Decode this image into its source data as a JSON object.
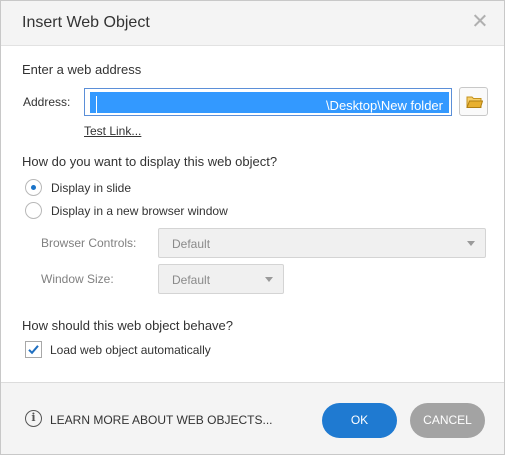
{
  "dialog": {
    "title": "Insert Web Object"
  },
  "address_section": {
    "heading": "Enter a web address",
    "address_label": "Address:",
    "address_value": "\\Desktop\\New folder",
    "test_link": "Test Link..."
  },
  "display_section": {
    "heading": "How do you want to display this web object?",
    "options": [
      {
        "label": "Display in slide",
        "selected": true
      },
      {
        "label": "Display in a new browser window",
        "selected": false
      }
    ],
    "browser_controls_label": "Browser Controls:",
    "browser_controls_value": "Default",
    "window_size_label": "Window Size:",
    "window_size_value": "Default"
  },
  "behave_section": {
    "heading": "How should this web object behave?",
    "load_auto_label": "Load web object automatically",
    "load_auto_checked": true
  },
  "footer": {
    "learn_more": "LEARN MORE ABOUT WEB OBJECTS...",
    "ok_label": "OK",
    "cancel_label": "CANCEL"
  },
  "colors": {
    "accent": "#1f7ad1",
    "selection": "#3399ff",
    "cancel": "#a3a3a3",
    "folder": "#e8b030"
  },
  "icons": {
    "close": "close-icon",
    "folder": "folder-icon",
    "info": "info-icon",
    "check": "checkmark-icon"
  }
}
